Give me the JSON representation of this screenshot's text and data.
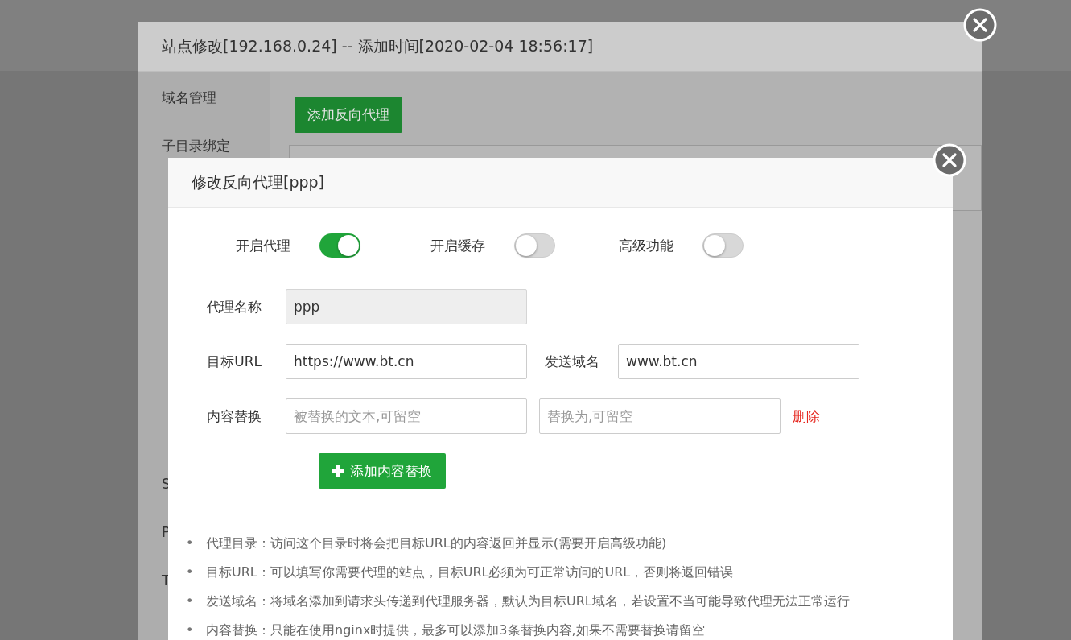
{
  "site_dialog": {
    "title": "站点修改[192.168.0.24] -- 添加时间[2020-02-04 18:56:17]",
    "sidebar": {
      "items": [
        {
          "label": "域名管理"
        },
        {
          "label": "子目录绑定"
        },
        {
          "label": "S"
        },
        {
          "label": "P"
        },
        {
          "label": "T"
        }
      ]
    },
    "add_proxy_button": "添加反向代理"
  },
  "proxy_dialog": {
    "title": "修改反向代理[ppp]",
    "switches": [
      {
        "label": "开启代理",
        "on": true
      },
      {
        "label": "开启缓存",
        "on": false
      },
      {
        "label": "高级功能",
        "on": false
      }
    ],
    "name_field": {
      "label": "代理名称",
      "value": "ppp",
      "disabled": true
    },
    "target_url_field": {
      "label": "目标URL",
      "value": "https://www.bt.cn"
    },
    "send_domain_field": {
      "label": "发送域名",
      "value": "www.bt.cn"
    },
    "replace_row": {
      "label": "内容替换",
      "from_placeholder": "被替换的文本,可留空",
      "to_placeholder": "替换为,可留空",
      "delete_link": "删除"
    },
    "add_replace_button": "添加内容替换",
    "notes": [
      {
        "bullet": "•",
        "text": "代理目录：访问这个目录时将会把目标URL的内容返回并显示(需要开启高级功能)"
      },
      {
        "bullet": "•",
        "text": "目标URL：可以填写你需要代理的站点，目标URL必须为可正常访问的URL，否则将返回错误"
      },
      {
        "bullet": "•",
        "text": "发送域名：将域名添加到请求头传递到代理服务器，默认为目标URL域名，若设置不当可能导致代理无法正常运行"
      },
      {
        "bullet": "•",
        "text": "内容替换：只能在使用nginx时提供，最多可以添加3条替换内容,如果不需要替换请留空"
      }
    ]
  }
}
